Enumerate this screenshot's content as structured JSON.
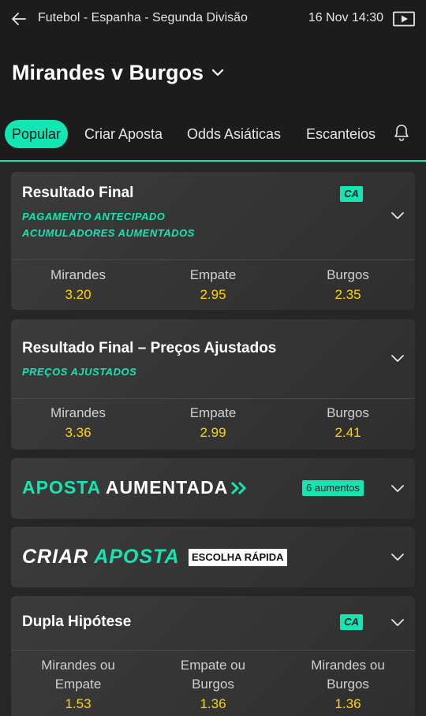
{
  "header": {
    "breadcrumb": "Futebol - Espanha - Segunda Divisão",
    "datetime": "16 Nov 14:30",
    "match_title": "Mirandes v Burgos"
  },
  "tabs": [
    {
      "label": "Popular",
      "active": true
    },
    {
      "label": "Criar Aposta"
    },
    {
      "label": "Odds Asiáticas"
    },
    {
      "label": "Escanteios"
    }
  ],
  "markets": {
    "resultado_final": {
      "title": "Resultado Final",
      "badge": "CA",
      "promos": [
        "PAGAMENTO ANTECIPADO",
        "ACUMULADORES AUMENTADOS"
      ],
      "selections": [
        {
          "name": "Mirandes",
          "odds": "3.20"
        },
        {
          "name": "Empate",
          "odds": "2.95"
        },
        {
          "name": "Burgos",
          "odds": "2.35"
        }
      ]
    },
    "precos_ajustados": {
      "title": "Resultado Final – Preços Ajustados",
      "promo": "PREÇOS AJUSTADOS",
      "selections": [
        {
          "name": "Mirandes",
          "odds": "3.36"
        },
        {
          "name": "Empate",
          "odds": "2.99"
        },
        {
          "name": "Burgos",
          "odds": "2.41"
        }
      ]
    },
    "aposta_aumentada": {
      "word1": "APOSTA",
      "word2": "AUMENTADA",
      "badge": "6 aumentos"
    },
    "criar_aposta": {
      "word1": "CRIAR",
      "word2": "APOSTA",
      "badge": "ESCOLHA RÁPIDA"
    },
    "dupla_hipotese": {
      "title": "Dupla Hipótese",
      "badge": "CA",
      "selections": [
        {
          "line1": "Mirandes ou",
          "line2": "Empate",
          "odds": "1.53"
        },
        {
          "line1": "Empate ou",
          "line2": "Burgos",
          "odds": "1.36"
        },
        {
          "line1": "Mirandes ou",
          "line2": "Burgos",
          "odds": "1.36"
        }
      ]
    }
  },
  "colors": {
    "accent": "#14e6b3",
    "odds": "#ffd400",
    "background": "#262626",
    "header": "#1c1c1c",
    "card": "#383838"
  },
  "icons": [
    "back-arrow-icon",
    "video-icon",
    "chevron-down-icon",
    "bell-icon",
    "double-chevron-right-icon"
  ]
}
